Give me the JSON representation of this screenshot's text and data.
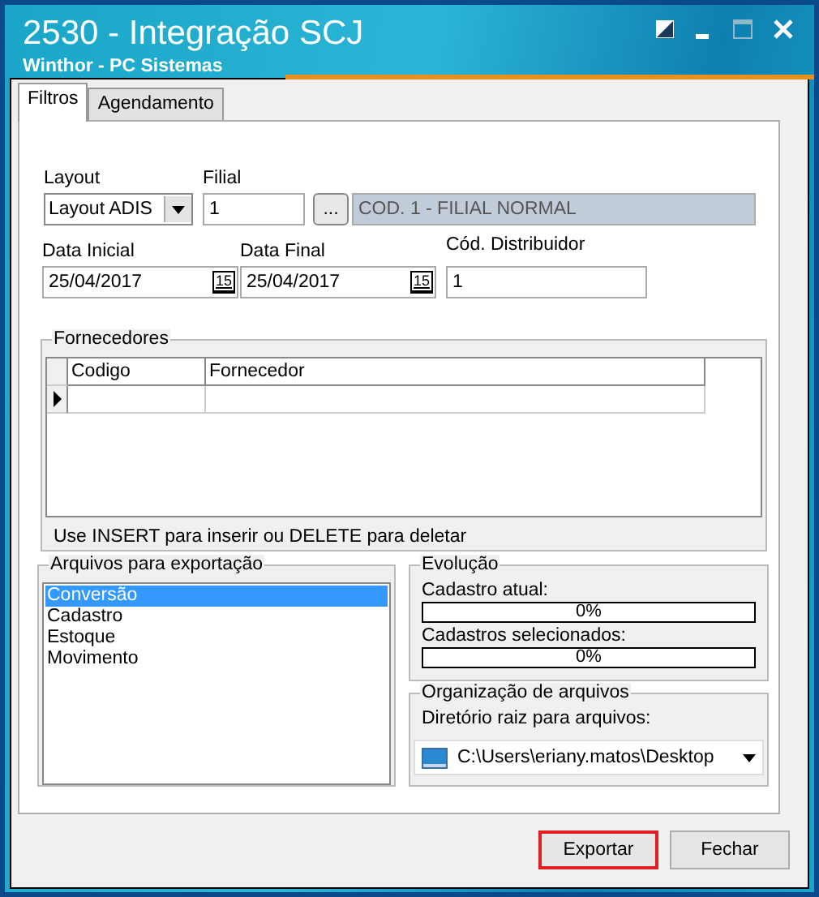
{
  "window": {
    "title": "2530 - Integração SCJ",
    "subtitle": "Winthor - PC Sistemas"
  },
  "tabs": [
    {
      "label": "Filtros",
      "selected": true
    },
    {
      "label": "Agendamento",
      "selected": false
    }
  ],
  "layout": {
    "label": "Layout",
    "value": "Layout ADIS"
  },
  "filial": {
    "label": "Filial",
    "value": "1",
    "lookup_button": "...",
    "description": "COD. 1 - FILIAL NORMAL"
  },
  "data_inicial": {
    "label": "Data Inicial",
    "value": "25/04/2017",
    "calendar_button": "15"
  },
  "data_final": {
    "label": "Data Final",
    "value": "25/04/2017",
    "calendar_button": "15"
  },
  "cod_distribuidor": {
    "label": "Cód. Distribuidor",
    "value": "1"
  },
  "fornecedores": {
    "title": "Fornecedores",
    "columns": [
      "Codigo",
      "Fornecedor"
    ],
    "hint": "Use INSERT para inserir ou DELETE para deletar"
  },
  "arquivos": {
    "title": "Arquivos para exportação",
    "items": [
      {
        "label": "Conversão",
        "selected": true
      },
      {
        "label": "Cadastro",
        "selected": false
      },
      {
        "label": "Estoque",
        "selected": false
      },
      {
        "label": "Movimento",
        "selected": false
      }
    ]
  },
  "evolucao": {
    "title": "Evolução",
    "bars": [
      {
        "label": "Cadastro atual:",
        "level": 0,
        "reading": "0%"
      },
      {
        "label": "Cadastros selecionados:",
        "level": 0,
        "reading": "0%"
      }
    ]
  },
  "organizacao": {
    "title": "Organização de arquivos",
    "label": "Diretório raiz para arquivos:",
    "value": "C:\\Users\\eriany.matos\\Desktop"
  },
  "buttons": [
    {
      "label": "Exportar",
      "highlighted": true
    },
    {
      "label": "Fechar",
      "highlighted": false
    }
  ]
}
